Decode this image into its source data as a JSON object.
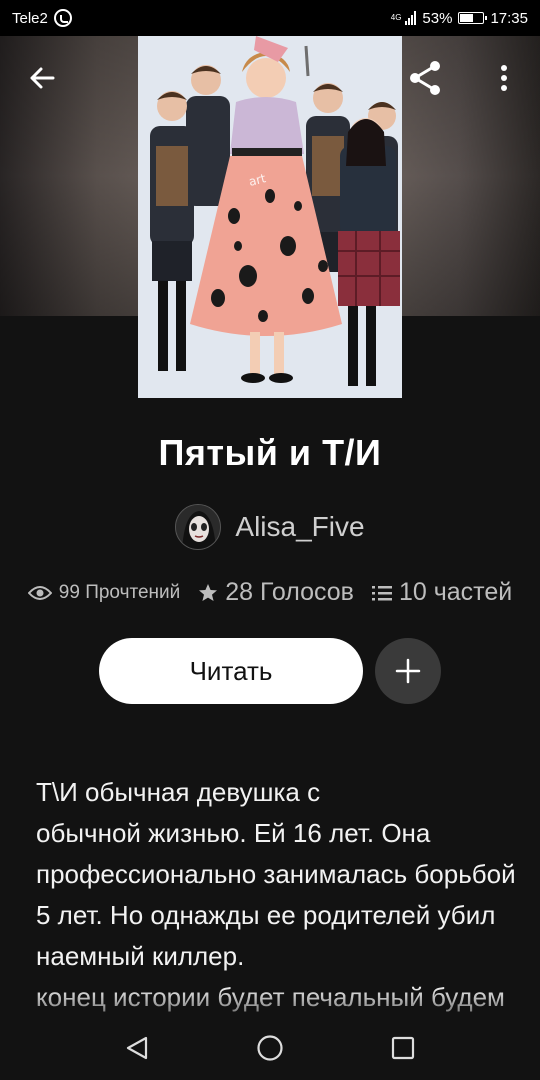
{
  "status_bar": {
    "carrier": "Tele2",
    "network": "4G",
    "battery": "53%",
    "time": "17:35"
  },
  "toolbar": {
    "back_icon": "arrow-left-icon",
    "share_icon": "share-icon",
    "more_icon": "more-vertical-icon"
  },
  "story": {
    "title": "Пятый и Т/И",
    "author": "Alisa_Five",
    "stats": {
      "reads": "99 Прочтений",
      "votes": "28 Голосов",
      "parts": "10 частей"
    },
    "read_label": "Читать",
    "add_icon": "plus-icon",
    "description_lines": [
      "Т\\И обычная девушка с",
      "обычной жизнью. Ей 16 лет. Она",
      "профессионально занималась борьбой",
      "5 лет. Но однажды ее родителей убил",
      "наемный киллер.",
      "конец истории будет печальный будем"
    ]
  },
  "nav_bar": {
    "back_icon": "triangle-back-icon",
    "home_icon": "circle-home-icon",
    "recents_icon": "square-recents-icon"
  },
  "colors": {
    "background": "#121212",
    "read_button": "#ffffff",
    "add_button": "#3a3a3a",
    "muted_text": "#bdbdbd"
  }
}
